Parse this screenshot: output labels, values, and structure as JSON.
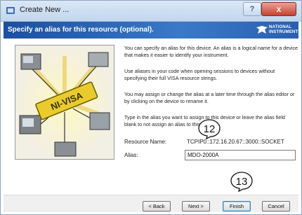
{
  "window": {
    "title": "Create New ...",
    "help_label": "?",
    "close_label": "x"
  },
  "header": {
    "text": "Specify an alias for this resource (optional).",
    "logo_line1": "NATIONAL",
    "logo_line2": "INSTRUMENTS"
  },
  "description": [
    "You can specify an alias for this device. An alias is a logical name for a device that makes it easier to identify your instrument.",
    "Use aliases in your code when opening sessions to devices without specifying their full VISA resource strings.",
    "You may assign or change the alias at a later time through the alias editor or by clicking on the device to rename it.",
    "Type in the alias you want to assign to this device or leave the alias field blank to not assign an alias to this device."
  ],
  "resource": {
    "label": "Resource Name:",
    "value": "TCPIP0::172.16.20.67::3000::SOCKET"
  },
  "alias": {
    "label": "Alias:",
    "value": "MDO-2000A"
  },
  "callouts": {
    "step12": "12",
    "step13": "13"
  },
  "buttons": {
    "back": "< Back",
    "next": "Next >",
    "finish": "Finish",
    "cancel": "Cancel"
  },
  "illustration": {
    "badge": "NI-VISA"
  }
}
